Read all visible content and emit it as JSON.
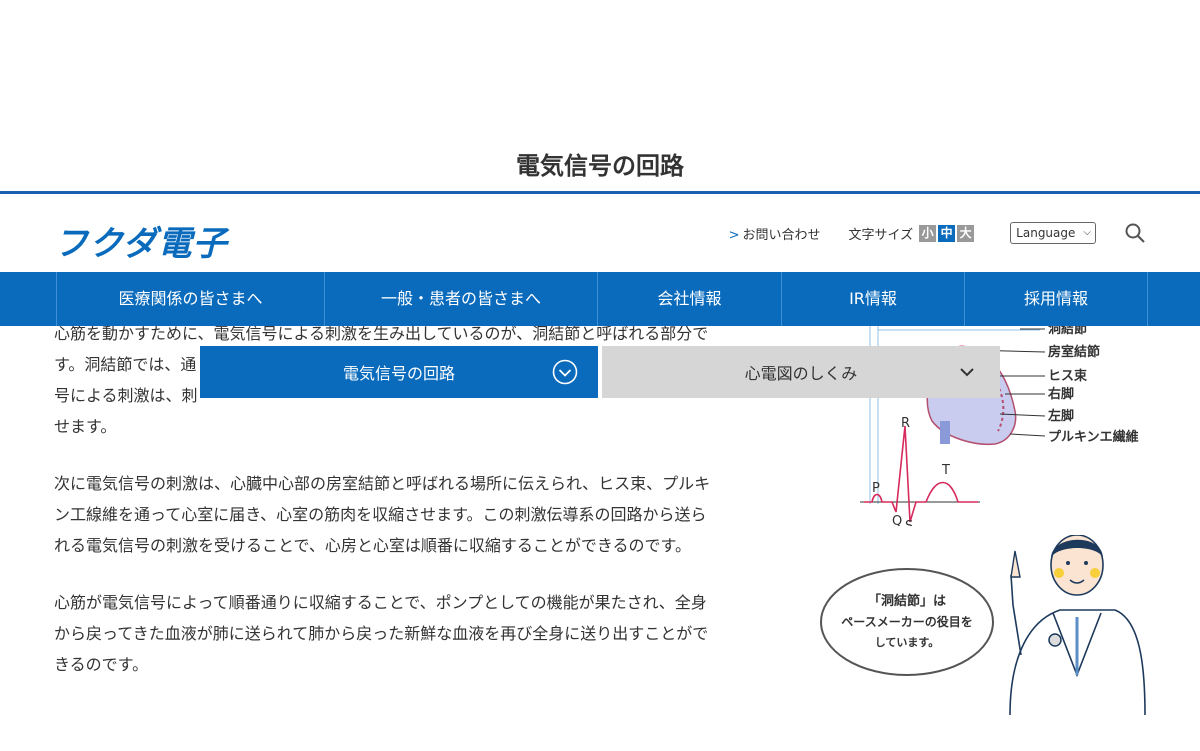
{
  "page_title": "電気信号の回路",
  "header": {
    "logo": "フクダ電子",
    "contact_arrow": ">",
    "contact": "お問い合わせ",
    "font_size_label": "文字サイズ",
    "font_sizes": [
      "小",
      "中",
      "大"
    ],
    "language": "Language"
  },
  "nav": [
    "医療関係の皆さまへ",
    "一般・患者の皆さまへ",
    "会社情報",
    "IR情報",
    "採用情報"
  ],
  "subtabs": {
    "active": "電気信号の回路",
    "inactive": "心電図のしくみ"
  },
  "content": {
    "p1": [
      "心筋を動かすために、電気信号による刺激を生み出しているのが、洞結節と呼ばれる部分で",
      "す。洞結節では、通",
      "号による刺激は、刺",
      "せます。"
    ],
    "p2": [
      "次に電気信号の刺激は、心臓中心部の房室結節と呼ばれる場所に伝えられ、ヒス束、プルキ",
      "ン工線維を通って心室に届き、心室の筋肉を収縮させます。この刺激伝導系の回路から送ら",
      "れる電気信号の刺激を受けることで、心房と心室は順番に収縮することができるのです。"
    ],
    "p3": [
      "心筋が電気信号によって順番通りに収縮することで、ポンプとしての機能が果たされ、全身",
      "から戻ってきた血液が肺に送られて肺から戻った新鮮な血液を再び全身に送り出すことがで",
      "きるのです。"
    ]
  },
  "figure": {
    "labels": [
      "洞結節",
      "房室結節",
      "ヒス束",
      "右脚",
      "左脚",
      "プルキンエ繊維"
    ],
    "ecg_labels": [
      "P",
      "Q",
      "R",
      "S",
      "T"
    ]
  },
  "bubble": {
    "line1": "「洞結節」は",
    "line2": "ペースメーカーの役目を",
    "line3": "しています。"
  },
  "colors": {
    "brand_blue": "#0a6bbd",
    "tab_gray": "#d7d6d6",
    "ecg_red": "#d62b5c"
  }
}
